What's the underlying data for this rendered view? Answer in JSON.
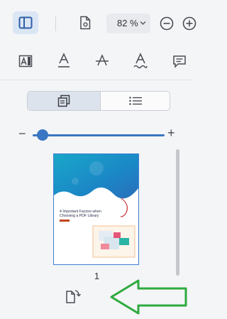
{
  "toolbar": {
    "zoom_value": "82 %",
    "icons": [
      "sidebar-toggle-icon",
      "page-settings-icon",
      "chevron-down-icon",
      "zoom-out-icon",
      "zoom-in-icon"
    ]
  },
  "format_bar": {
    "icons": [
      "text-box-icon",
      "underline-icon",
      "strikethrough-icon",
      "squiggly-underline-icon",
      "comment-icon"
    ]
  },
  "view_toggle": {
    "options": [
      "thumbnails-view-icon",
      "outline-list-icon"
    ],
    "selected": "thumbnails-view-icon"
  },
  "zoom_slider": {
    "minus": "−",
    "plus": "+",
    "level": 0.08
  },
  "thumbnail": {
    "title_line1": "4 Important Factors when",
    "title_line2": "Choosing a PDF Library",
    "page_number": "1"
  },
  "colors": {
    "accent": "#3a76c2",
    "thumb_border": "#3f7fd0",
    "arrow_green": "#2eaa3e",
    "panel_bg": "#f4f5f7"
  }
}
